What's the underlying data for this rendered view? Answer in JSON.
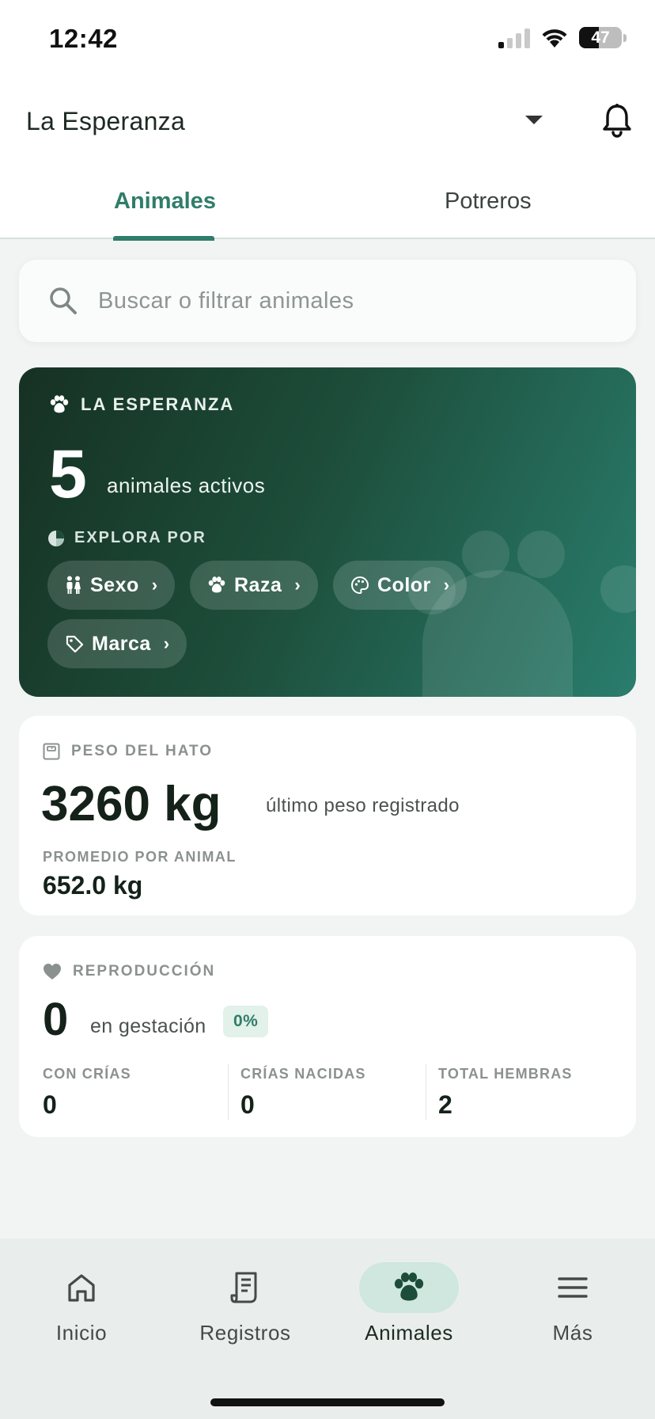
{
  "status_bar": {
    "time": "12:42",
    "battery": "47",
    "battery_level": 0.47
  },
  "header": {
    "farm_name": "La Esperanza"
  },
  "tabs": [
    {
      "label": "Animales",
      "active": true
    },
    {
      "label": "Potreros",
      "active": false
    }
  ],
  "search": {
    "placeholder": "Buscar o filtrar animales",
    "value": ""
  },
  "hero": {
    "farm_label": "LA ESPERANZA",
    "active_count": "5",
    "active_label": "animales activos",
    "explore_label": "EXPLORA POR",
    "chips": [
      {
        "label": "Sexo",
        "icon": "sex-icon"
      },
      {
        "label": "Raza",
        "icon": "paw-icon"
      },
      {
        "label": "Color",
        "icon": "palette-icon"
      },
      {
        "label": "Marca",
        "icon": "tag-icon"
      }
    ]
  },
  "peso": {
    "title": "PESO DEL HATO",
    "value": "3260 kg",
    "value_label": "último peso registrado",
    "avg_label": "PROMEDIO POR ANIMAL",
    "avg_value": "652.0 kg"
  },
  "reproduccion": {
    "title": "REPRODUCCIÓN",
    "value": "0",
    "value_label": "en gestación",
    "badge": "0%",
    "stats": [
      {
        "label": "CON CRÍAS",
        "value": "0"
      },
      {
        "label": "CRÍAS NACIDAS",
        "value": "0"
      },
      {
        "label": "TOTAL HEMBRAS",
        "value": "2"
      }
    ]
  },
  "bottom_nav": [
    {
      "label": "Inicio",
      "icon": "home-icon",
      "active": false
    },
    {
      "label": "Registros",
      "icon": "receipt-icon",
      "active": false
    },
    {
      "label": "Animales",
      "icon": "paw-icon",
      "active": true
    },
    {
      "label": "Más",
      "icon": "menu-icon",
      "active": false
    }
  ],
  "colors": {
    "accent": "#2f7d6a",
    "hero_dark": "#163123",
    "hero_light": "#2a7d6d",
    "badge_bg": "#e2f1ea"
  }
}
